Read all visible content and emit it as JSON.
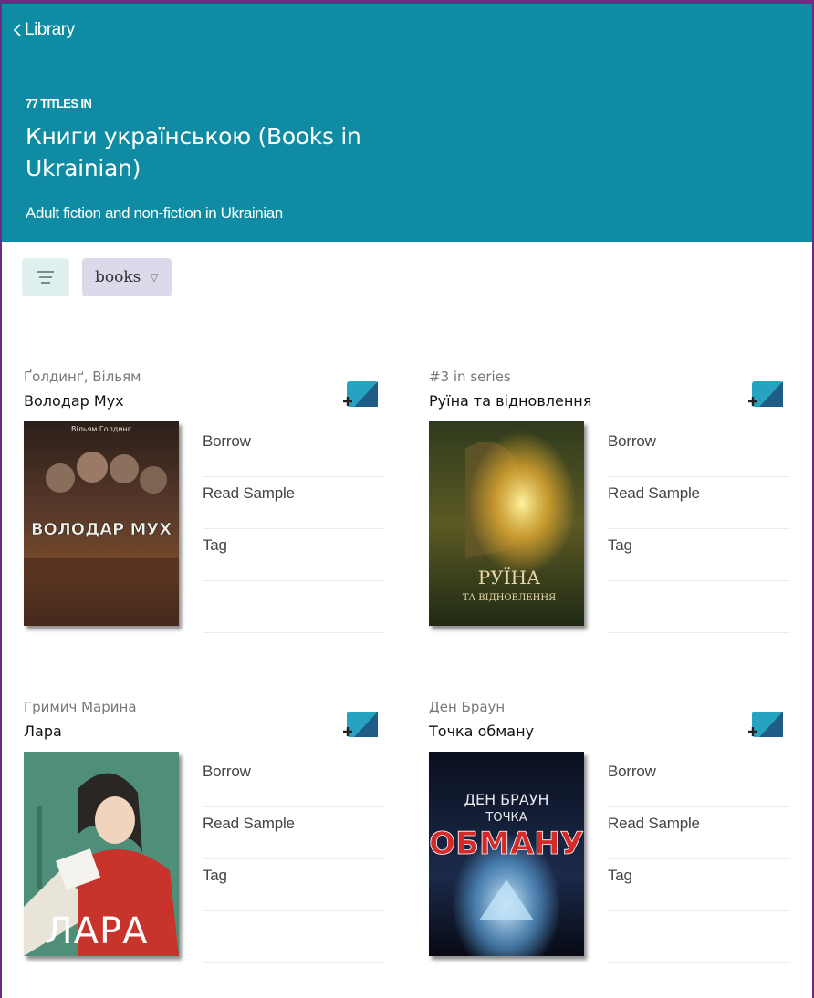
{
  "nav": {
    "back_label": "Library"
  },
  "header": {
    "count": "77 TITLES IN",
    "title": "Книги українською (Books in Ukrainian)",
    "description": "Adult fiction and non-fiction in Ukrainian"
  },
  "toolbar": {
    "filter_label": "books"
  },
  "actions": {
    "borrow": "Borrow",
    "sample": "Read Sample",
    "tag": "Tag"
  },
  "books": [
    {
      "author": "Ґолдинґ, Вільям",
      "title": "Володар Мух",
      "cover_author": "Вільям Голдинг",
      "cover_title": "ВОЛОДАР МУХ"
    },
    {
      "author": "#3 in series",
      "title": "Руїна та відновлення",
      "cover_title_1": "РУЇНА",
      "cover_title_2": "ТА ВІДНОВЛЕННЯ"
    },
    {
      "author": "Гримич Марина",
      "title": "Лара",
      "cover_title": "ЛАРА"
    },
    {
      "author": "Ден Браун",
      "title": "Точка обману",
      "cover_author": "ДЕН БРАУН",
      "cover_subtitle": "ТОЧКА",
      "cover_title": "ОБМАНУ"
    }
  ],
  "colors": {
    "header_bg": "#0f8ca3",
    "accent": "#0f8ca3",
    "chip_bg": "#dcd9ea",
    "menu_bg": "#dff0ef"
  }
}
